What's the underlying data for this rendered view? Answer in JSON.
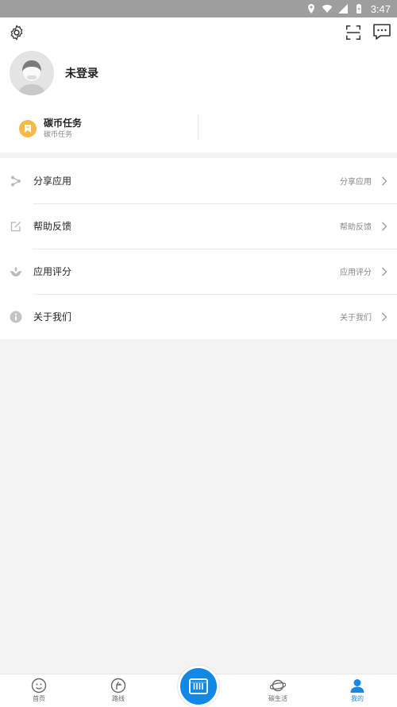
{
  "status_bar": {
    "time": "3:47"
  },
  "header": {
    "login_text": "未登录",
    "task_title": "碳币任务",
    "task_subtitle": "碳币任务"
  },
  "menu": {
    "items": [
      {
        "label": "分享应用",
        "right": "分享应用",
        "icon": "share-icon"
      },
      {
        "label": "帮助反馈",
        "right": "帮助反馈",
        "icon": "edit-icon"
      },
      {
        "label": "应用评分",
        "right": "应用评分",
        "icon": "rating-icon"
      },
      {
        "label": "关于我们",
        "right": "关于我们",
        "icon": "info-icon"
      }
    ]
  },
  "tabbar": {
    "tabs": [
      {
        "label": "首页",
        "icon": "home-icon"
      },
      {
        "label": "路线",
        "icon": "route-icon"
      },
      {
        "label": "碳生活",
        "icon": "planet-icon"
      },
      {
        "label": "我的",
        "icon": "user-icon",
        "active": true
      }
    ],
    "center_icon": "bus-card-icon"
  },
  "colors": {
    "accent": "#1288e4",
    "task_icon": "#f6b94a",
    "status_bar": "#9e9e9e"
  }
}
